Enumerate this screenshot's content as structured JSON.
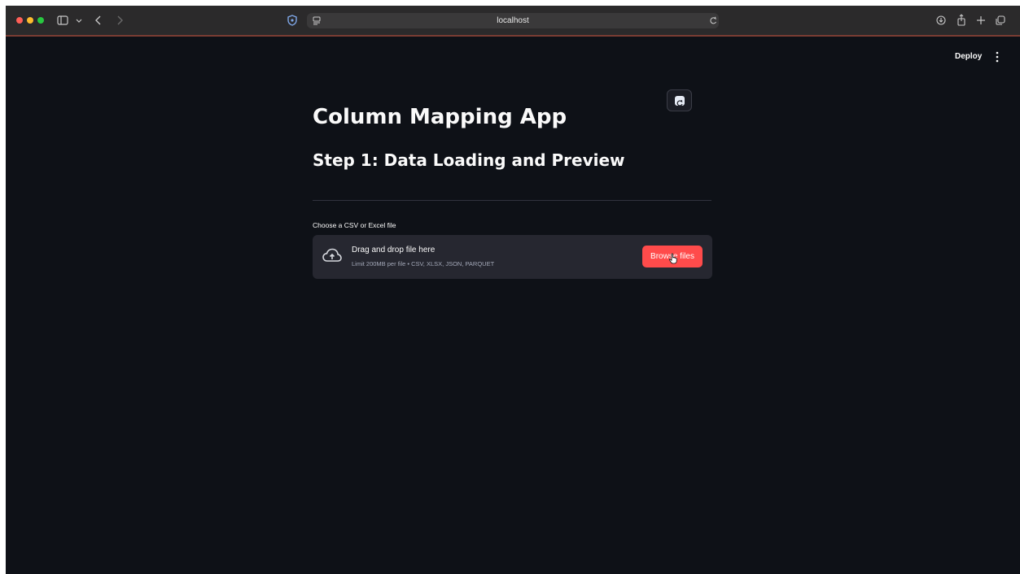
{
  "browser": {
    "url": "localhost",
    "icons": [
      "sidebar-icon",
      "chevron-down-icon",
      "back-icon",
      "forward-icon",
      "shield-icon",
      "page-icon",
      "reload-icon",
      "download-icon",
      "share-icon",
      "new-tab-icon",
      "tabs-icon"
    ]
  },
  "header": {
    "deploy_label": "Deploy",
    "menu_icon": "kebab-menu-icon"
  },
  "main": {
    "title": "Column Mapping App",
    "subtitle": "Step 1: Data Loading and Preview",
    "uploader": {
      "label": "Choose a CSV or Excel file",
      "drop_title": "Drag and drop file here",
      "drop_limit": "Limit 200MB per file • CSV, XLSX, JSON, PARQUET",
      "browse_label": "Browse files",
      "icon": "cloud-upload-icon"
    }
  },
  "colors": {
    "background": "#0e1117",
    "accent": "#ff4b4b",
    "dropzone": "#262730",
    "toolbar": "#2b2a2b"
  }
}
